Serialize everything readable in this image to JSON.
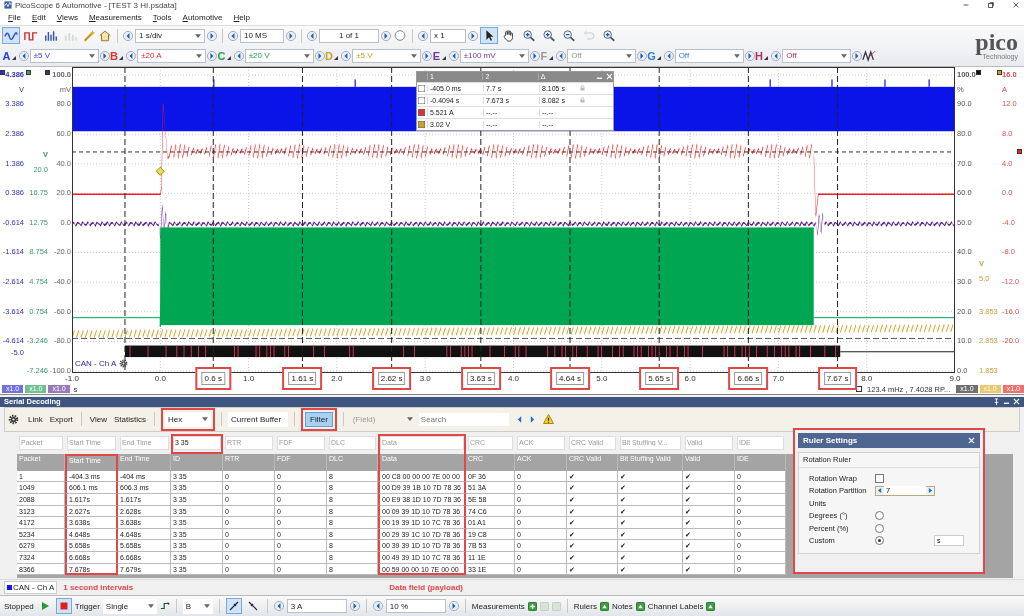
{
  "window": {
    "title": "PicoScope 6 Automotive - [TEST 3 HI.psdata]"
  },
  "menu": [
    "File",
    "Edit",
    "Views",
    "Measurements",
    "Tools",
    "Automotive",
    "Help"
  ],
  "toolbar": {
    "view_modes": [
      {
        "kind": "scope",
        "selected": true,
        "disabled": false
      },
      {
        "kind": "persistence",
        "selected": false,
        "disabled": false
      },
      {
        "kind": "spectrum",
        "selected": false,
        "disabled": false
      },
      {
        "kind": "bars",
        "selected": false,
        "disabled": true
      }
    ],
    "timebase": "1 s/div",
    "samples": "10 MS",
    "buffer": "1 of 1",
    "zoom": "x 1",
    "tools": [
      {
        "kind": "pointer",
        "selected": true,
        "disabled": false
      },
      {
        "kind": "hand",
        "selected": false,
        "disabled": false
      },
      {
        "kind": "zoom-in",
        "selected": false,
        "disabled": false
      },
      {
        "kind": "zoom-area",
        "selected": false,
        "disabled": false
      },
      {
        "kind": "zoom-out",
        "selected": false,
        "disabled": false
      },
      {
        "kind": "undo",
        "selected": false,
        "disabled": true
      },
      {
        "kind": "zoom-fit",
        "selected": false,
        "disabled": false
      }
    ]
  },
  "channels": [
    {
      "letter": "A",
      "range": "±5 V",
      "color": "#2b3fd8"
    },
    {
      "letter": "B",
      "range": "±20 A",
      "color": "#e03030"
    },
    {
      "letter": "C",
      "range": "±20 V",
      "color": "#1fa050"
    },
    {
      "letter": "D",
      "range": "±5 V",
      "color": "#c9a227"
    },
    {
      "letter": "E",
      "range": "±100 mV",
      "color": "#6a3d9a"
    },
    {
      "letter": "F",
      "range": "Off",
      "color": "#9a9a9a"
    },
    {
      "letter": "G",
      "range": "Off",
      "color": "#2f7fd0"
    },
    {
      "letter": "H",
      "range": "Off",
      "color": "#b0305a"
    }
  ],
  "logo": {
    "name": "pico",
    "tagline": "Technology"
  },
  "scope": {
    "left_axes": [
      {
        "color": "#3030c8",
        "ticks": [
          "4.386",
          "V",
          "3.386",
          "2.386",
          "1.386",
          "0.386",
          "-0.614",
          "-1.614",
          "-2.614",
          "-3.614",
          "-4.614",
          "-5.0"
        ]
      },
      {
        "color": "#3a9a6a",
        "ticks": [
          "V",
          "20.0",
          "16.75",
          "12.75",
          "8.754",
          "4.754",
          "0.754",
          "-3.246",
          "-7.246"
        ]
      },
      {
        "color": "#666666",
        "ticks": [
          "100.0",
          "mV",
          "80.0",
          "60.0",
          "40.0",
          "20.0",
          "0.0",
          "-20.0",
          "-40.0",
          "-60.0",
          "-80.0",
          "-100.0"
        ]
      }
    ],
    "right_axes": [
      {
        "color": "#555555",
        "ticks": [
          "100.0",
          "%",
          "90.0",
          "80.0",
          "70.0",
          "60.0",
          "50.0",
          "40.0",
          "30.0",
          "20.0",
          "10.0",
          "0.0"
        ]
      },
      {
        "color": "#c89b3c",
        "ticks": [
          "V",
          "5.0",
          "3.853",
          "2.853",
          "1.853"
        ]
      },
      {
        "color": "#e05050",
        "ticks": [
          "16.0",
          "A",
          "12.0",
          "8.0",
          "4.0",
          "0.0",
          "-4.0",
          "-8.0",
          "-12.0",
          "-16.0",
          "-20.0"
        ]
      }
    ],
    "x_ticks": [
      "-1.0",
      "0.0",
      "1.0",
      "2.0",
      "3.0",
      "4.0",
      "5.0",
      "6.0",
      "7.0",
      "8.0",
      "9.0"
    ],
    "rulers": [
      {
        "label": "0.6 s",
        "highlighted": true
      },
      {
        "label": "1.61 s",
        "highlighted": true
      },
      {
        "label": "2.62 s",
        "highlighted": true
      },
      {
        "label": "3.63 s",
        "highlighted": true
      },
      {
        "label": "4.64 s",
        "highlighted": true
      },
      {
        "label": "5.65 s",
        "highlighted": true
      },
      {
        "label": "6.66 s",
        "highlighted": true
      },
      {
        "label": "7.67 s",
        "highlighted": true
      }
    ],
    "cursor_table": {
      "headers": [
        "1",
        "2",
        "Δ"
      ],
      "rows": [
        {
          "color": "#ffffff",
          "locked": true,
          "cells": [
            "-405.0 ms",
            "7.7 s",
            "8.105 s"
          ]
        },
        {
          "color": "#ffffff",
          "locked": true,
          "cells": [
            "-0.4094 s",
            "7.673 s",
            "8.082 s"
          ]
        },
        {
          "color": "#e03030",
          "locked": false,
          "cells": [
            "5.521 A",
            "--.--",
            "--.--"
          ]
        },
        {
          "color": "#c9a227",
          "locked": false,
          "cells": [
            "3.02 V",
            "--.--",
            "--.--"
          ]
        }
      ]
    },
    "channel_label": "CAN - Ch A",
    "left_badges": [
      {
        "label": "x1.0",
        "color": "#7070e0"
      },
      {
        "label": "x1.0",
        "color": "#70c090"
      },
      {
        "label": "x1.0",
        "color": "#9a7ab8"
      }
    ],
    "time_unit": "s",
    "readout": "123.4 mHz , 7.4028 RP...",
    "right_badges": [
      {
        "label": "x1.0",
        "color": "#707070"
      },
      {
        "label": "x1.0",
        "color": "#e8c870"
      },
      {
        "label": "x1.0",
        "color": "#f07070"
      }
    ]
  },
  "serial_decoding": {
    "title": "Serial Decoding",
    "links": [
      "Link",
      "Export",
      "View",
      "Statistics"
    ],
    "format": {
      "value": "Hex",
      "highlighted": true
    },
    "buffer": "Current Buffer",
    "filter": {
      "label": "Filter",
      "highlighted": true
    },
    "field": "(Field)",
    "search": {
      "placeholder": "Search"
    },
    "filters": [
      {
        "placeholder": "Packet",
        "highlighted": false
      },
      {
        "placeholder": "Start Time",
        "highlighted": false
      },
      {
        "placeholder": "End Time",
        "highlighted": false
      },
      {
        "value": "3 35",
        "highlighted": true
      },
      {
        "placeholder": "RTR",
        "highlighted": false
      },
      {
        "placeholder": "FDF",
        "highlighted": false
      },
      {
        "placeholder": "DLC",
        "highlighted": false
      },
      {
        "placeholder": "Data",
        "highlighted": true
      },
      {
        "placeholder": "CRC",
        "highlighted": false
      },
      {
        "placeholder": "ACK",
        "highlighted": false
      },
      {
        "placeholder": "CRC Valid",
        "highlighted": false
      },
      {
        "placeholder": "Bit Stuffing V...",
        "highlighted": false
      },
      {
        "placeholder": "Valid",
        "highlighted": false
      },
      {
        "placeholder": "IDE",
        "highlighted": false
      }
    ],
    "columns": [
      {
        "label": "Packet",
        "highlighted": false
      },
      {
        "label": "Start Time",
        "highlighted": true
      },
      {
        "label": "End Time",
        "highlighted": false
      },
      {
        "label": "ID",
        "highlighted": false
      },
      {
        "label": "RTR",
        "highlighted": false
      },
      {
        "label": "FDF",
        "highlighted": false
      },
      {
        "label": "DLC",
        "highlighted": false
      },
      {
        "label": "Data",
        "highlighted": true
      },
      {
        "label": "CRC",
        "highlighted": false
      },
      {
        "label": "ACK",
        "highlighted": false
      },
      {
        "label": "CRC Valid",
        "highlighted": false
      },
      {
        "label": "Bit Stuffing Valid",
        "highlighted": false
      },
      {
        "label": "Valid",
        "highlighted": false
      },
      {
        "label": "IDE",
        "highlighted": false
      }
    ],
    "rows": [
      [
        "1",
        "-404.3 ms",
        "-404 ms",
        "3 35",
        "0",
        "0",
        "8",
        "00 C8 00 00 00 7E 00 00",
        "0F 36",
        "0",
        "✔",
        "✔",
        "✔",
        "0"
      ],
      [
        "1049",
        "606.1 ms",
        "606.3 ms",
        "3 35",
        "0",
        "0",
        "8",
        "00 D9 39 1B 10 7D 78 36",
        "51 3A",
        "0",
        "✔",
        "✔",
        "✔",
        "0"
      ],
      [
        "2088",
        "1.617s",
        "1.617s",
        "3 35",
        "0",
        "0",
        "8",
        "00 E9 38 1D 10 7D 78 36",
        "5E 58",
        "0",
        "✔",
        "✔",
        "✔",
        "0"
      ],
      [
        "3123",
        "2.627s",
        "2.628s",
        "3 35",
        "0",
        "0",
        "8",
        "00 09 39 1D 10 7D 78 36",
        "74 C6",
        "0",
        "✔",
        "✔",
        "✔",
        "0"
      ],
      [
        "4172",
        "3.638s",
        "3.638s",
        "3 35",
        "0",
        "0",
        "8",
        "00 19 39 1D 10 7C 78 36",
        "01 A1",
        "0",
        "✔",
        "✔",
        "✔",
        "0"
      ],
      [
        "5234",
        "4.648s",
        "4.648s",
        "3 35",
        "0",
        "0",
        "8",
        "00 29 39 1C 10 7D 78 36",
        "19 C8",
        "0",
        "✔",
        "✔",
        "✔",
        "0"
      ],
      [
        "6279",
        "5.658s",
        "5.658s",
        "3 35",
        "0",
        "0",
        "8",
        "00 39 39 1D 10 7D 78 36",
        "7B 53",
        "0",
        "✔",
        "✔",
        "✔",
        "0"
      ],
      [
        "7324",
        "6.668s",
        "6.668s",
        "3 35",
        "0",
        "0",
        "8",
        "00 49 39 1D 10 7C 78 36",
        "11 1E",
        "0",
        "✔",
        "✔",
        "✔",
        "0"
      ],
      [
        "8366",
        "7.678s",
        "7.679s",
        "3 35",
        "0",
        "0",
        "8",
        "00 59 00 00 10 7E 00 00",
        "33 1E",
        "0",
        "✔",
        "✔",
        "✔",
        "0"
      ]
    ],
    "tab": "CAN - Ch A",
    "annotations": [
      "1 second intervals",
      "Data field (payload)"
    ],
    "ruler_settings": {
      "title": "Ruler Settings",
      "highlighted": true,
      "group": "Rotation Ruler",
      "wrap_label": "Rotation Wrap",
      "wrap_checked": false,
      "partition_label": "Rotation Partition",
      "partition": "7",
      "units_label": "Units",
      "units": [
        {
          "label": "Degrees (°)",
          "selected": false
        },
        {
          "label": "Percent (%)",
          "selected": false
        },
        {
          "label": "Custom",
          "selected": true
        }
      ],
      "custom_unit": "s"
    }
  },
  "status_bar": {
    "state": "Stopped",
    "run": {
      "selected": false
    },
    "stop": {
      "selected": true
    },
    "trigger_label": "Trigger",
    "trigger_mode": "Single",
    "trigger_source": "B",
    "edge_modes": [
      {
        "kind": "rising",
        "selected": true
      },
      {
        "kind": "falling",
        "selected": false
      }
    ],
    "threshold": "3 A",
    "pre_trigger": "10 %",
    "measurements_label": "Measurements",
    "measurement_buttons": [
      {
        "kind": "add",
        "disabled": false
      },
      {
        "kind": "edit",
        "disabled": true
      },
      {
        "kind": "remove",
        "disabled": true
      }
    ],
    "toggles": [
      "Rulers",
      "Notes",
      "Channel Labels"
    ]
  }
}
